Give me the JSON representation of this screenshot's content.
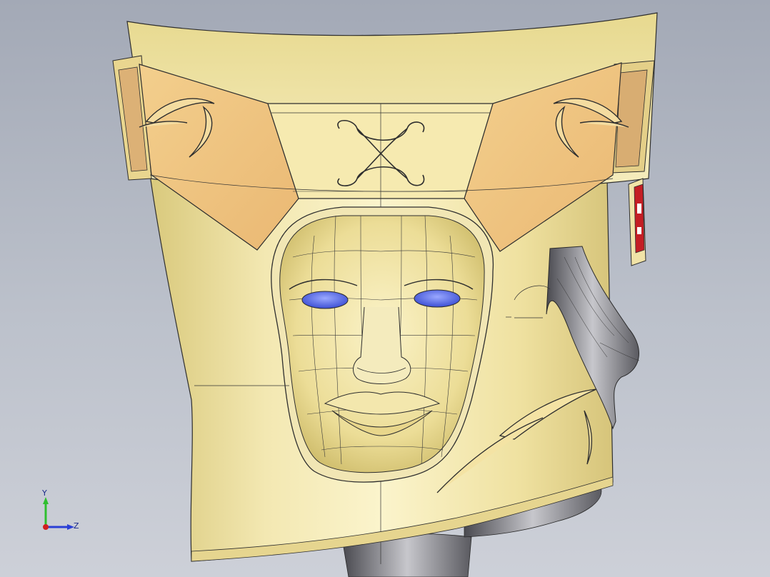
{
  "viewport": {
    "background_top": "#a3a9b6",
    "background_bottom": "#cdd0d8"
  },
  "model": {
    "helmet_color": "#efe3a3",
    "panel_color": "#f0c987",
    "eye_color": "#5b6fe6",
    "metal_color": "#8c8c92",
    "accent_color": "#c41e24"
  },
  "triad": {
    "y_label": "Y",
    "z_label": "Z",
    "y_color": "#2fbf2f",
    "z_color": "#2a3fd6",
    "origin_color": "#d02020"
  }
}
